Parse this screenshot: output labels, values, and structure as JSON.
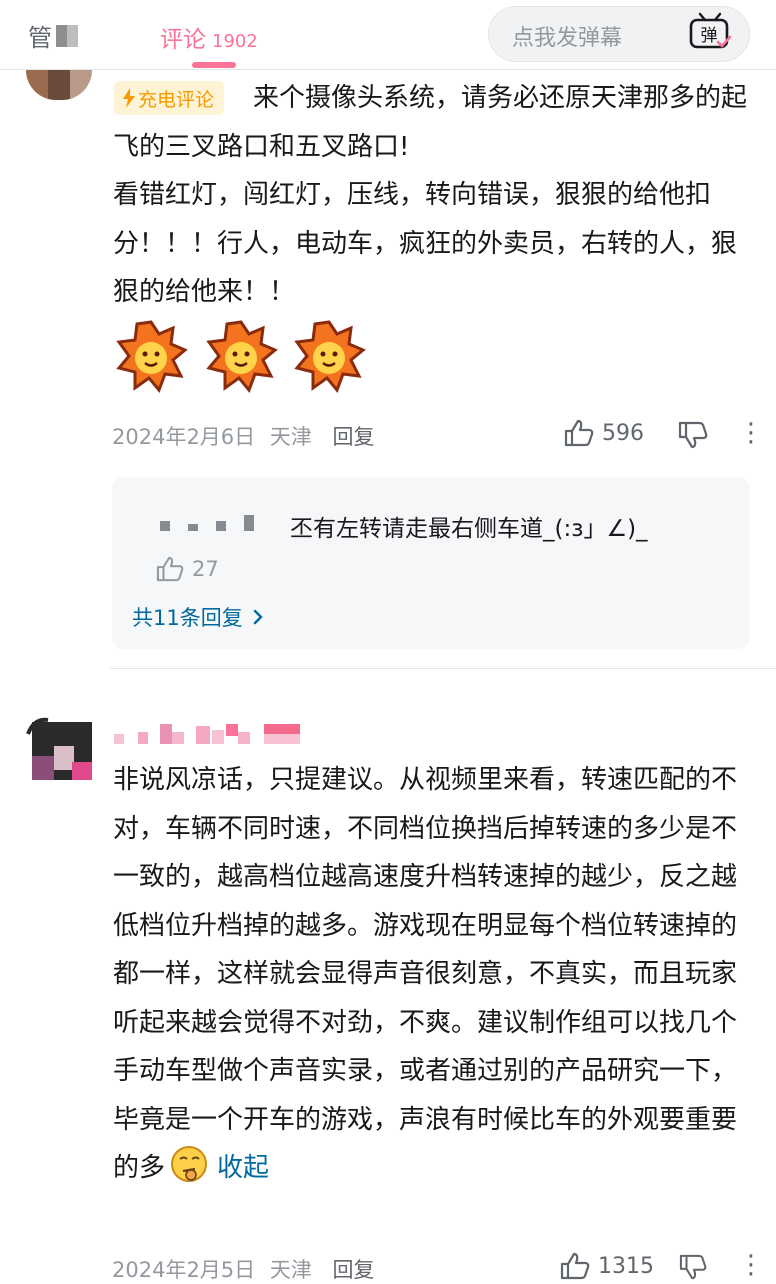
{
  "header": {
    "left_text": "管",
    "tab_label": "评论",
    "tab_count": "1902",
    "danmu_placeholder": "点我发弹幕",
    "danmu_button": "弹",
    "icons": {
      "danmu": "tv-danmu-icon"
    }
  },
  "comments": [
    {
      "badge_label": "充电评论",
      "badge_icon": "lightning-icon",
      "text": "来个摄像头系统，请务必还原天津那多的起飞的三叉路口和五叉路口!\n看错红灯，闯红灯，压线，转向错误，狠狠的给他扣分！！！行人，电动车，疯狂的外卖员，右转的人，狠狠的给他来！！",
      "emojis": [
        "explosion-emoji",
        "explosion-emoji",
        "explosion-emoji"
      ],
      "date": "2024年2月6日",
      "location": "天津",
      "reply_label": "回复",
      "likes": "596",
      "replies": {
        "text": "丕有左转请走最右侧车道_(:з」∠)_",
        "likes": "27",
        "more_label": "共11条回复"
      }
    },
    {
      "text": "非说风凉话，只提建议。从视频里来看，转速匹配的不对，车辆不同时速，不同档位换挡后掉转速的多少是不一致的，越高档位越高速度升档转速掉的越少，反之越低档位升档掉的越多。游戏现在明显每个档位转速掉的都一样，这样就会显得声音很刻意，不真实，而且玩家听起来越会觉得不对劲，不爽。建议制作组可以找几个手动车型做个声音实录，或者通过别的产品研究一下，毕竟是一个开车的游戏，声浪有时候比车的外观要重要的多",
      "collapse_label": "收起",
      "date": "2024年2月5日",
      "location": "天津",
      "reply_label": "回复",
      "likes": "1315"
    }
  ],
  "colors": {
    "accent": "#fb7299",
    "link": "#00699d",
    "meta": "#9499a0"
  }
}
